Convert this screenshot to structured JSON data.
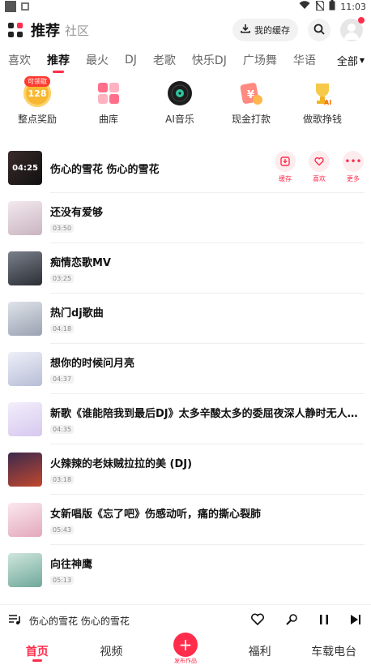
{
  "status": {
    "time": "11:03"
  },
  "header": {
    "title": "推荐",
    "subtitle": "社区",
    "cache_label": "我的缓存"
  },
  "tabs": [
    "喜欢",
    "推荐",
    "最火",
    "DJ",
    "老歌",
    "快乐DJ",
    "广场舞",
    "华语"
  ],
  "tabs_all": "全部",
  "quick": [
    {
      "label": "整点奖励",
      "badge": "可领取",
      "value": "128"
    },
    {
      "label": "曲库"
    },
    {
      "label": "AI音乐"
    },
    {
      "label": "现金打款"
    },
    {
      "label": "做歌挣钱"
    }
  ],
  "actions": {
    "cache": "缓存",
    "like": "喜欢",
    "more": "更多"
  },
  "songs": [
    {
      "title": "伤心的雪花 伤心的雪花",
      "cover_text": "04:25"
    },
    {
      "title": "还没有爱够",
      "duration": "03:50"
    },
    {
      "title": "痴情恋歌MV",
      "duration": "03:25"
    },
    {
      "title": "热门dj歌曲",
      "duration": "04:18"
    },
    {
      "title": "想你的时候问月亮",
      "duration": "04:37"
    },
    {
      "title": "新歌《谁能陪我到最后DJ》太多辛酸太多的委屈夜深人静时无人倾诉",
      "duration": "04:35"
    },
    {
      "title": "火辣辣的老妹贼拉拉的美 (DJ)",
      "duration": "03:18"
    },
    {
      "title": "女新唱版《忘了吧》伤感动听，痛的撕心裂肺",
      "duration": "05:43"
    },
    {
      "title": "向往神鹰",
      "duration": "05:13"
    }
  ],
  "player": {
    "title": "伤心的雪花 伤心的雪花"
  },
  "nav": {
    "home": "首页",
    "video": "视频",
    "publish": "发布作品",
    "welfare": "福利",
    "car": "车载电台"
  },
  "colors": {
    "accent": "#ff2d4b"
  }
}
